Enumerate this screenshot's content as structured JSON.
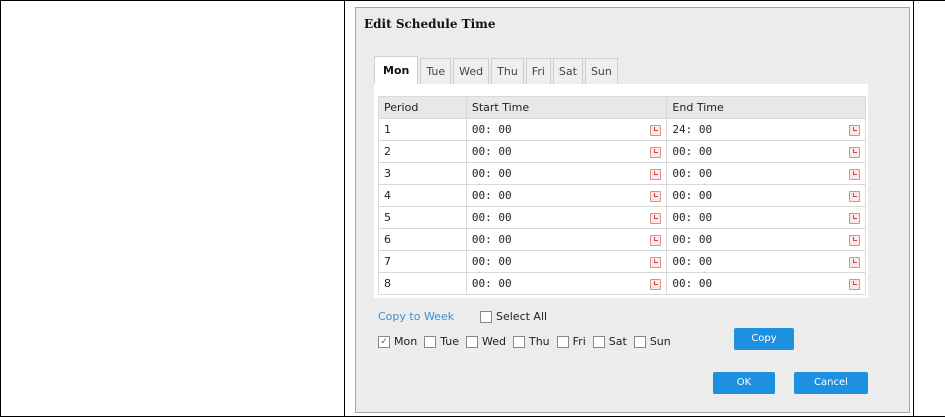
{
  "dialog": {
    "title": "Edit Schedule Time"
  },
  "tabs": [
    "Mon",
    "Tue",
    "Wed",
    "Thu",
    "Fri",
    "Sat",
    "Sun"
  ],
  "table": {
    "headers": [
      "Period",
      "Start Time",
      "End Time"
    ],
    "rows": [
      {
        "period": "1",
        "start": "00: 00",
        "end": "24: 00"
      },
      {
        "period": "2",
        "start": "00: 00",
        "end": "00: 00"
      },
      {
        "period": "3",
        "start": "00: 00",
        "end": "00: 00"
      },
      {
        "period": "4",
        "start": "00: 00",
        "end": "00: 00"
      },
      {
        "period": "5",
        "start": "00: 00",
        "end": "00: 00"
      },
      {
        "period": "6",
        "start": "00: 00",
        "end": "00: 00"
      },
      {
        "period": "7",
        "start": "00: 00",
        "end": "00: 00"
      },
      {
        "period": "8",
        "start": "00: 00",
        "end": "00: 00"
      }
    ]
  },
  "copy": {
    "label": "Copy to Week",
    "select_all": "Select All",
    "days": [
      {
        "label": "Mon",
        "checked": true
      },
      {
        "label": "Tue",
        "checked": false
      },
      {
        "label": "Wed",
        "checked": false
      },
      {
        "label": "Thu",
        "checked": false
      },
      {
        "label": "Fri",
        "checked": false
      },
      {
        "label": "Sat",
        "checked": false
      },
      {
        "label": "Sun",
        "checked": false
      }
    ],
    "copy_button": "Copy"
  },
  "buttons": {
    "ok": "OK",
    "cancel": "Cancel"
  },
  "colors": {
    "accent": "#1e90e0",
    "link": "#3b8fd0"
  }
}
